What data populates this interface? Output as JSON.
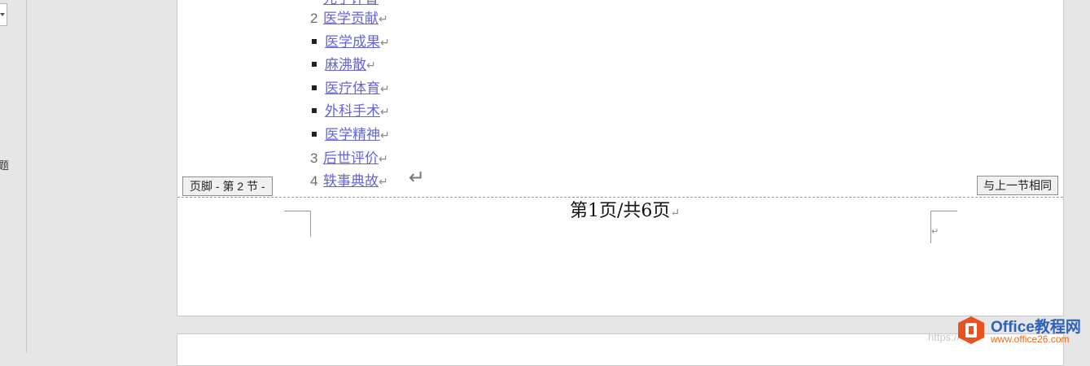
{
  "left_pane": {
    "fragment_text": "题"
  },
  "document": {
    "toc_items": [
      {
        "marker": "2",
        "text": "医学贡献"
      },
      {
        "marker": "bullet",
        "text": "医学成果"
      },
      {
        "marker": "bullet",
        "text": "麻沸散"
      },
      {
        "marker": "bullet",
        "text": "医疗体育"
      },
      {
        "marker": "bullet",
        "text": "外科手术"
      },
      {
        "marker": "bullet",
        "text": "医学精神"
      },
      {
        "marker": "3",
        "text": "后世评价"
      },
      {
        "marker": "4",
        "text": "轶事典故"
      }
    ],
    "top_cut_text": "元子评曾",
    "paragraph_mark": "↵",
    "footer_label": "页脚 - 第 2 节 -",
    "same_as_previous_label": "与上一节相同",
    "page_number_text": "第1页/共6页"
  },
  "watermark": {
    "url_text": "https://",
    "brand_title": "Office教程网",
    "brand_url": "www.office26.com",
    "colors": {
      "orange": "#e8521e",
      "blue": "#2d62b8"
    }
  },
  "colors": {
    "link": "#6464dc",
    "background": "#e6e6e6"
  }
}
